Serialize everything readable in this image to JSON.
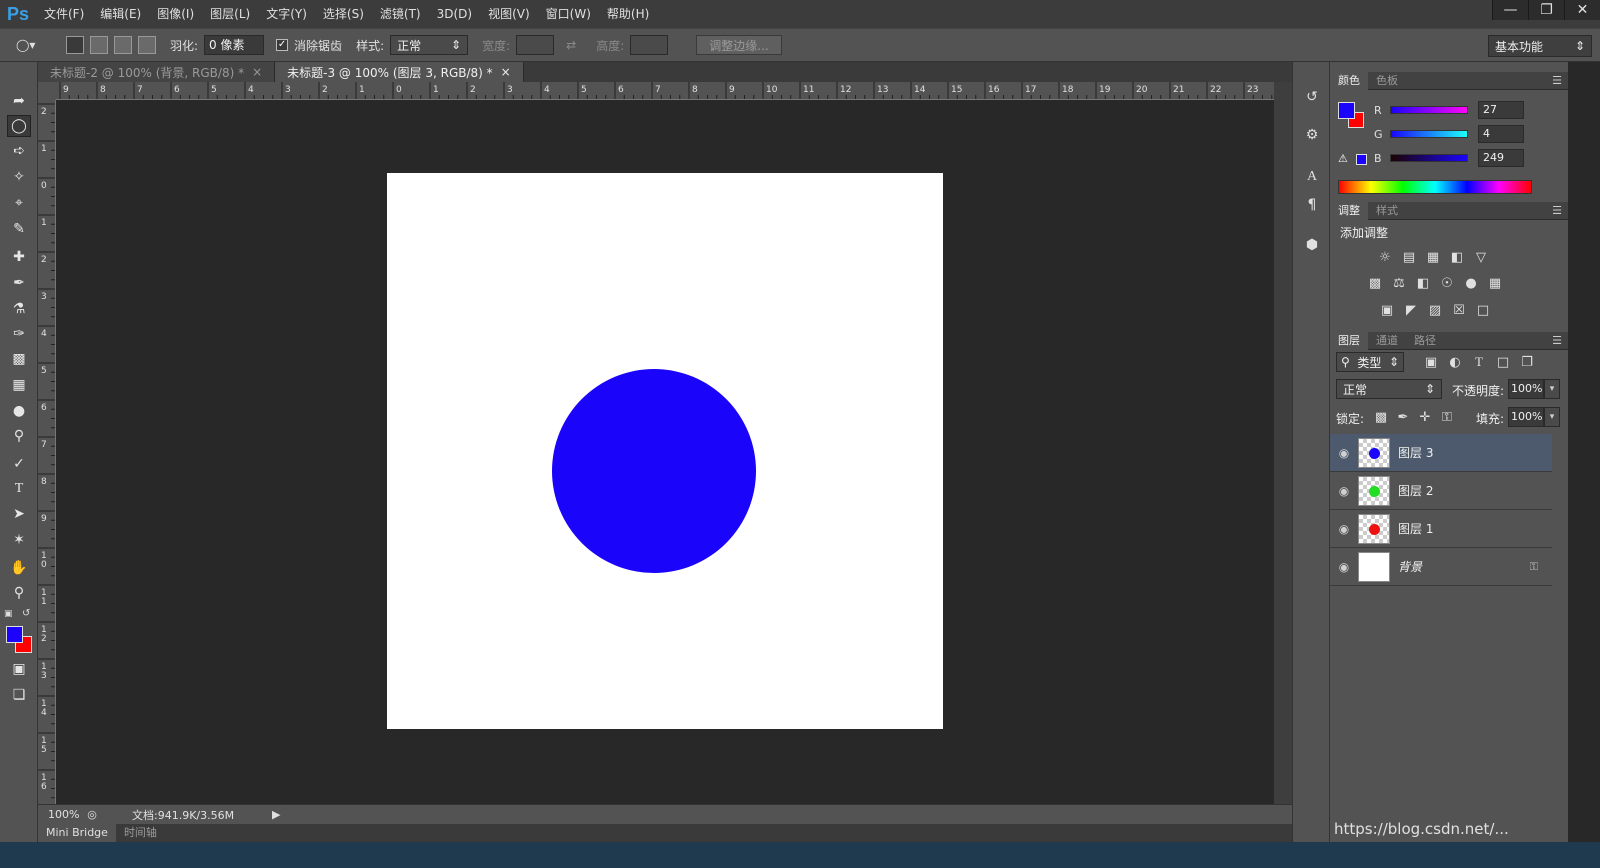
{
  "app": {
    "logo": "Ps",
    "menu": [
      "文件(F)",
      "编辑(E)",
      "图像(I)",
      "图层(L)",
      "文字(Y)",
      "选择(S)",
      "滤镜(T)",
      "3D(D)",
      "视图(V)",
      "窗口(W)",
      "帮助(H)"
    ],
    "window_controls": [
      "minimize-icon",
      "restore-icon",
      "close-icon"
    ]
  },
  "options": {
    "feather_label": "羽化:",
    "feather_value": "0 像素",
    "antialias_label": "消除锯齿",
    "antialias_checked": true,
    "style_label": "样式:",
    "style_value": "正常",
    "width_label": "宽度:",
    "height_label": "高度:",
    "refine_edge": "调整边缘...",
    "workspace": "基本功能"
  },
  "tabs": [
    {
      "title": "未标题-2 @ 100% (背景, RGB/8) *",
      "active": false
    },
    {
      "title": "未标题-3 @ 100% (图层 3, RGB/8) *",
      "active": true
    }
  ],
  "ruler": {
    "top": [
      "9",
      "8",
      "7",
      "6",
      "5",
      "4",
      "3",
      "2",
      "1",
      "0",
      "1",
      "2",
      "3",
      "4",
      "5",
      "6",
      "7",
      "8",
      "9",
      "10",
      "11",
      "12",
      "13",
      "14",
      "15",
      "16",
      "17",
      "18",
      "19",
      "20",
      "21",
      "22",
      "23"
    ],
    "left": [
      "2",
      "1",
      "0",
      "1",
      "2",
      "3",
      "4",
      "5",
      "6",
      "7",
      "8",
      "9",
      "10",
      "11",
      "12",
      "13",
      "14",
      "15",
      "16"
    ]
  },
  "canvas": {
    "background": "#ffffff",
    "circle_color": "#1a04f9"
  },
  "status": {
    "zoom": "100%",
    "doc": "文档:941.9K/3.56M"
  },
  "bottom_tabs": [
    "Mini Bridge",
    "时间轴"
  ],
  "colors": {
    "foreground": "#1b04f9",
    "background": "#ff0000"
  },
  "color_panel": {
    "tabs": [
      "颜色",
      "色板"
    ],
    "R": {
      "label": "R",
      "value": "27"
    },
    "G": {
      "label": "G",
      "value": "4"
    },
    "B": {
      "label": "B",
      "value": "249"
    }
  },
  "adjust_panel": {
    "tabs": [
      "调整",
      "样式"
    ],
    "title": "添加调整"
  },
  "layers_panel": {
    "tabs": [
      "图层",
      "通道",
      "路径"
    ],
    "filter": "类型",
    "blend_mode": "正常",
    "opacity_label": "不透明度:",
    "opacity": "100%",
    "lock_label": "锁定:",
    "fill_label": "填充:",
    "fill": "100%",
    "layers": [
      {
        "name": "图层 3",
        "dot": "#1a04f9",
        "selected": true
      },
      {
        "name": "图层 2",
        "dot": "#22dd22",
        "selected": false
      },
      {
        "name": "图层 1",
        "dot": "#ee1111",
        "selected": false
      },
      {
        "name": "背景",
        "dot": "",
        "selected": false,
        "locked": true
      }
    ]
  },
  "watermark": "https://blog.csdn.net/..."
}
